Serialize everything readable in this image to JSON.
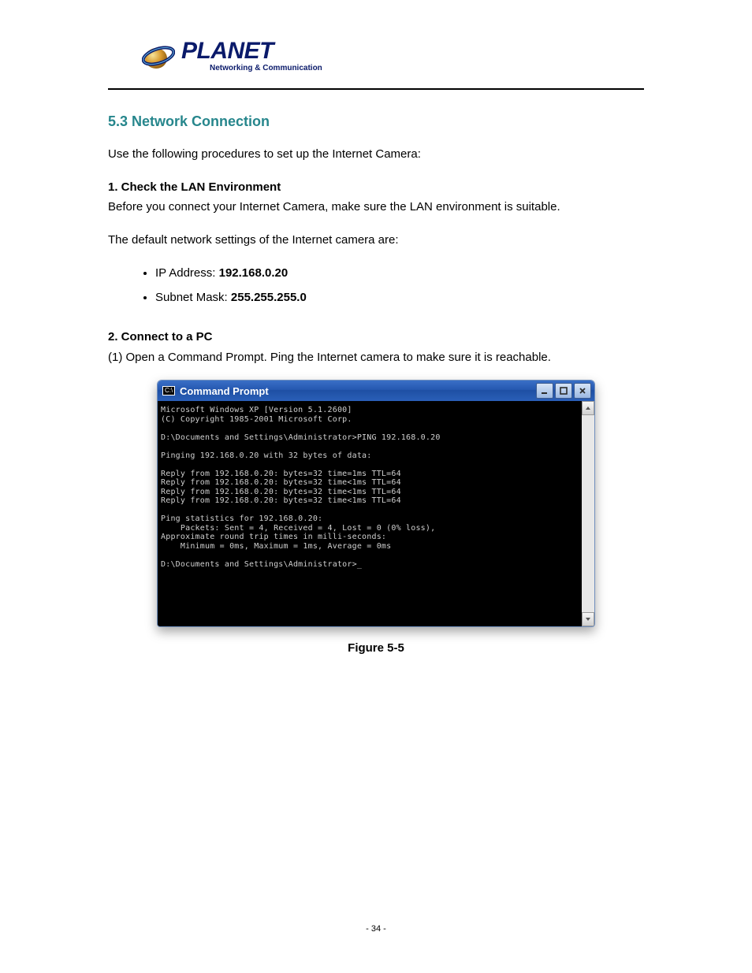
{
  "header": {
    "brand": "PLANET",
    "tagline": "Networking & Communication"
  },
  "section": {
    "title": "5.3 Network Connection",
    "p1_a": "Use the following procedures to set up the Internet Camera:",
    "p2": "1. Check the LAN Environment ",
    "p2_a": "Before you connect your Internet Camera, make sure the LAN environment is suitable. ",
    "p3": "The default network settings of the Internet camera are: ",
    "bullet1_label": "IP Address: ",
    "bullet1_val": "192.168.0.20",
    "bullet2_label": "Subnet Mask: ",
    "bullet2_val": "255.255.255.0 ",
    "p4": "2. Connect to a PC ",
    "p4_a": "(1) Open a Command Prompt. Ping the Internet camera to make sure it is reachable. "
  },
  "cmd": {
    "title": "Command Prompt",
    "line1": "Microsoft Windows XP [Version 5.1.2600]",
    "line2": "(C) Copyright 1985-2001 Microsoft Corp.",
    "line3": "D:\\Documents and Settings\\Administrator>PING 192.168.0.20",
    "line4": "Pinging 192.168.0.20 with 32 bytes of data:",
    "line5": "Reply from 192.168.0.20: bytes=32 time=1ms TTL=64",
    "line6": "Reply from 192.168.0.20: bytes=32 time<1ms TTL=64",
    "line7": "Reply from 192.168.0.20: bytes=32 time<1ms TTL=64",
    "line8": "Reply from 192.168.0.20: bytes=32 time<1ms TTL=64",
    "line9": "Ping statistics for 192.168.0.20:",
    "line10": "    Packets: Sent = 4, Received = 4, Lost = 0 (0% loss),",
    "line11": "Approximate round trip times in milli-seconds:",
    "line12": "    Minimum = 0ms, Maximum = 1ms, Average = 0ms",
    "line13": "D:\\Documents and Settings\\Administrator>_"
  },
  "caption": "Figure 5-5 ",
  "footer": "- 34 - "
}
